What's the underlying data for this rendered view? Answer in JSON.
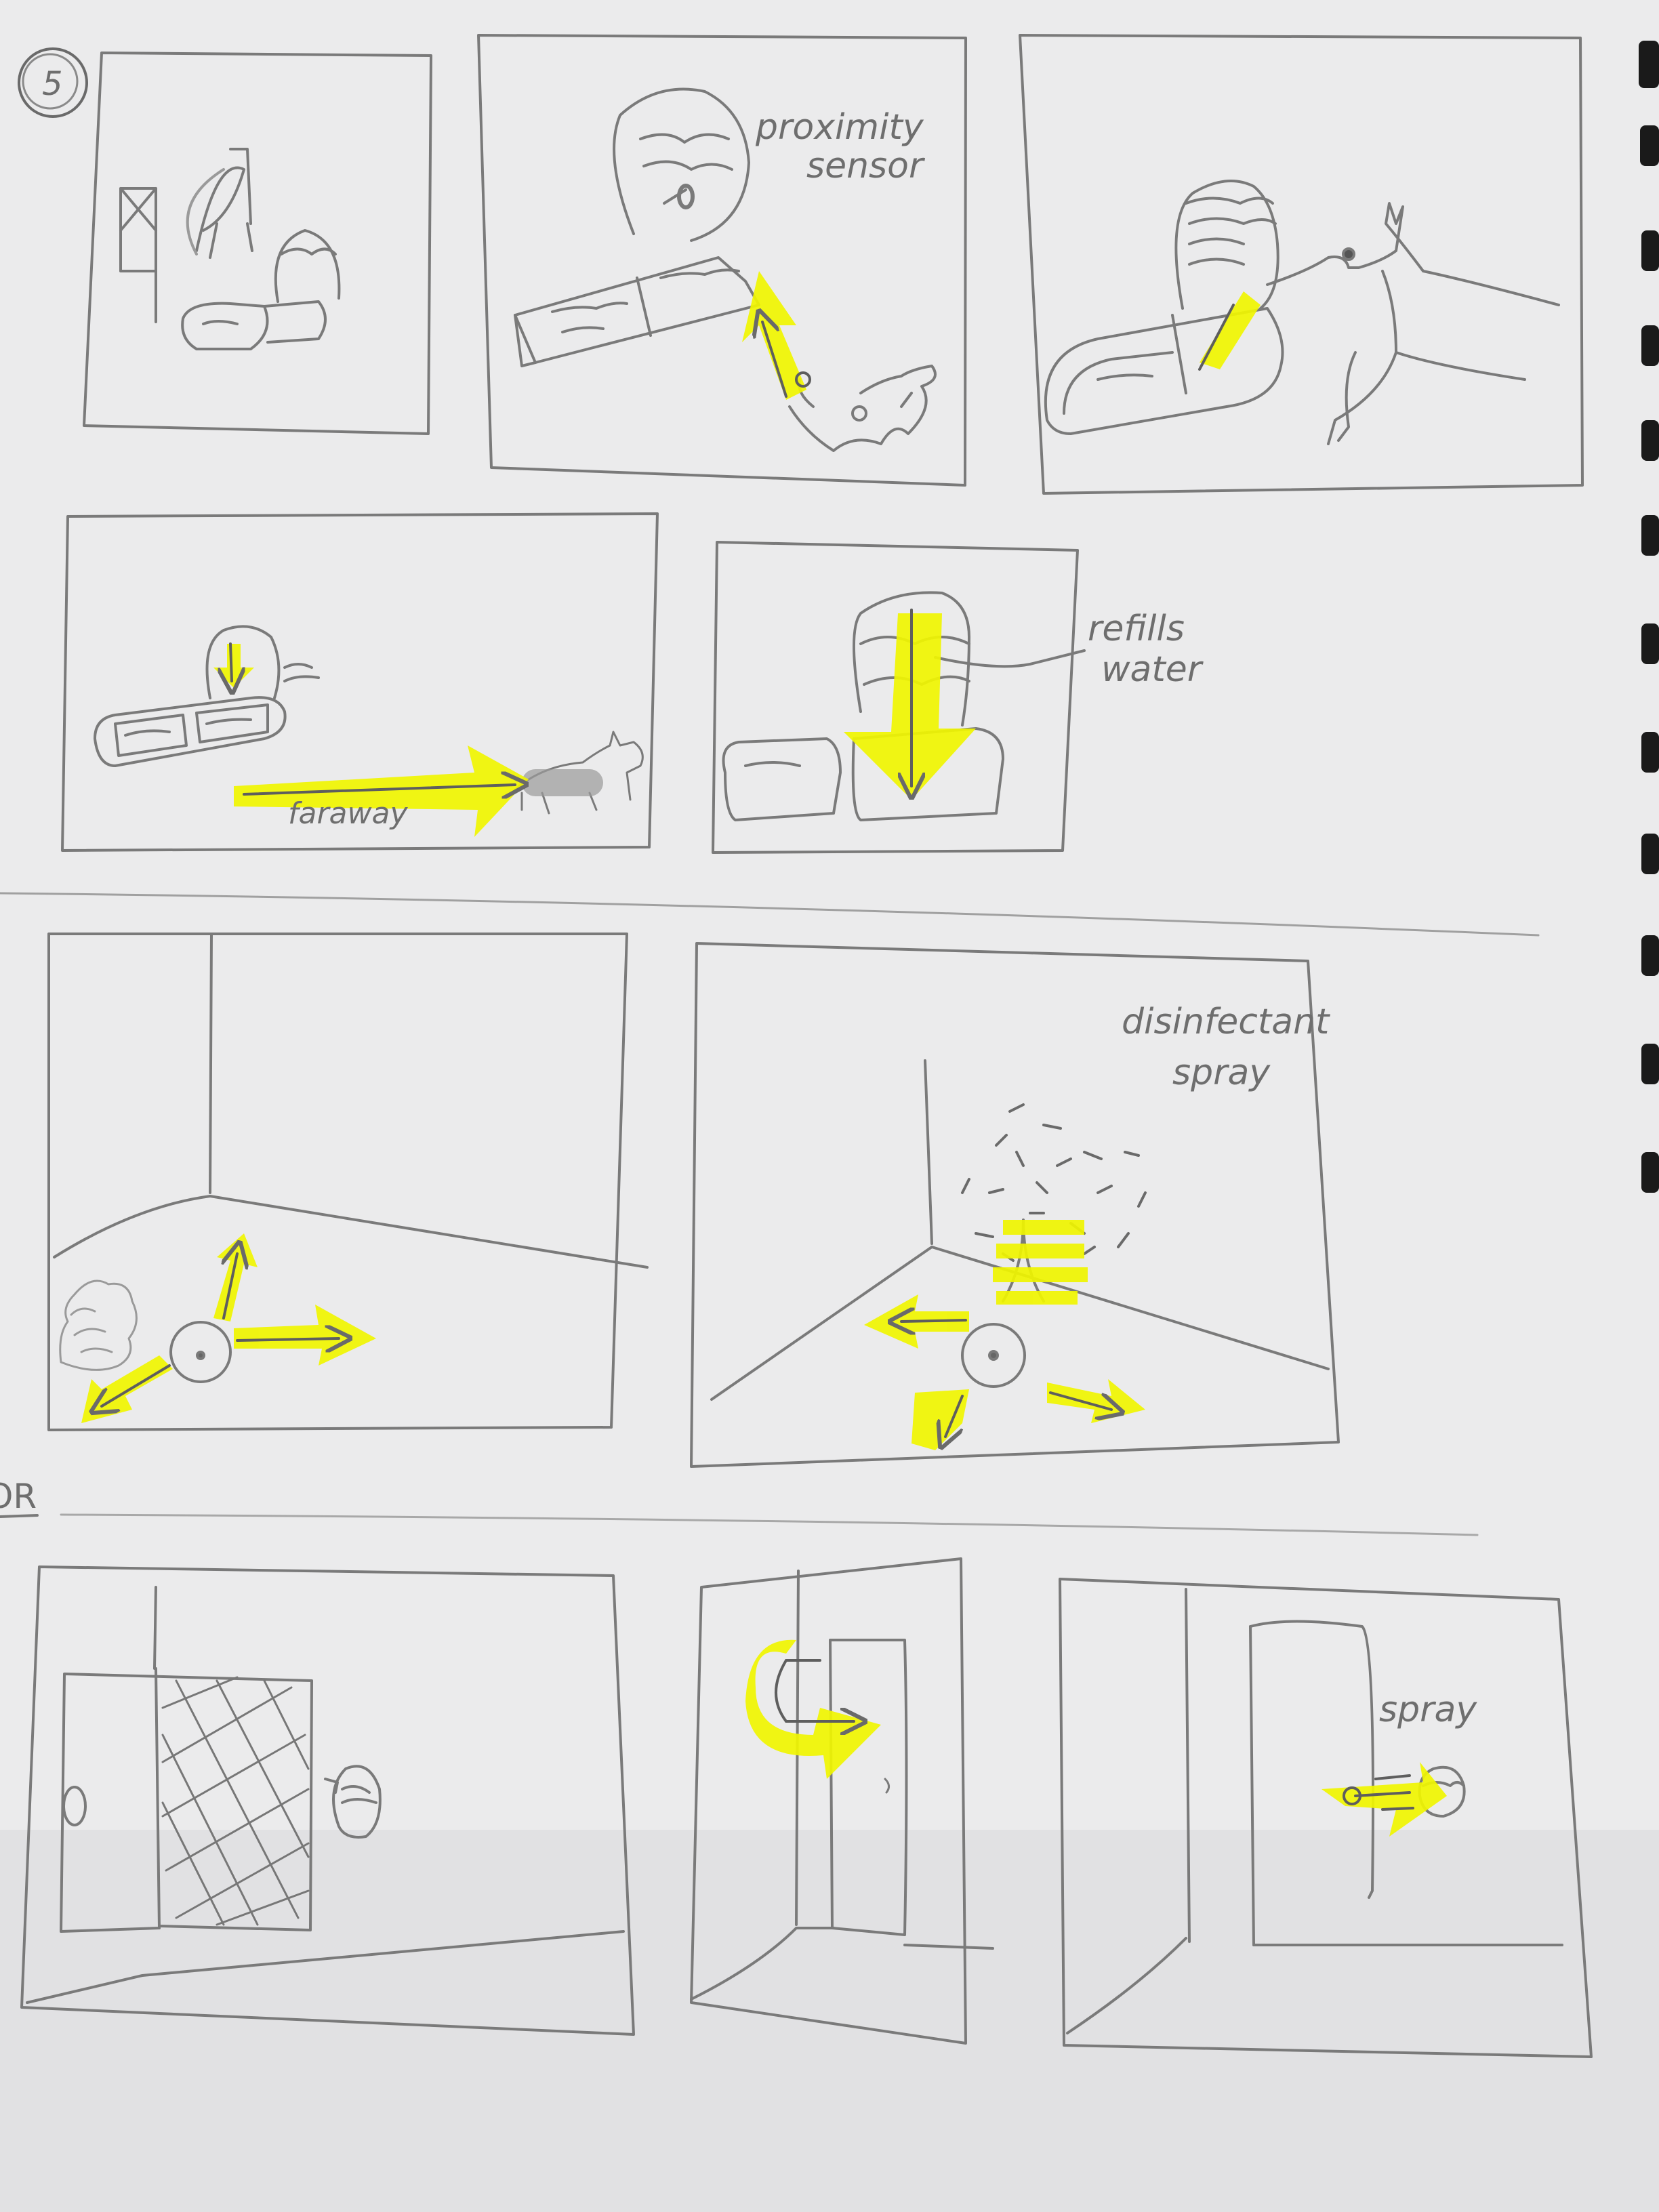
{
  "page": {
    "paper_color": "#ebebec",
    "pencil_color": "#7a7a7a",
    "highlight_color": "#f0f500",
    "binding_color": "#1a1a1a"
  },
  "labels": {
    "scene_number": "5",
    "proximity_sensor_line1": "proximity",
    "proximity_sensor_line2": "sensor",
    "refills_line1": "refills",
    "refills_line2": "water",
    "faraway": "faraway",
    "disinfectant_line1": "disinfectant",
    "disinfectant_line2": "spray",
    "door_spray": "spray",
    "section_or": "OR"
  },
  "icons": {
    "spiral_binding": "binding-hole-icon",
    "arrow": "highlighter-arrow-icon"
  }
}
